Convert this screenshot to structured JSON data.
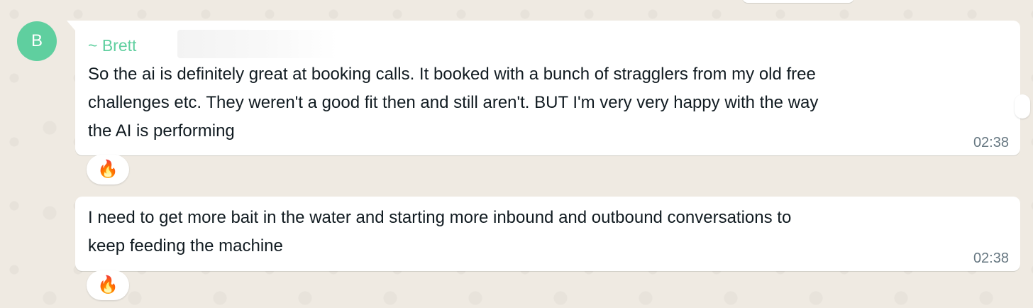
{
  "chat": {
    "avatar_initial": "B",
    "messages": [
      {
        "sender": "~ Brett",
        "text": "So the ai is definitely great at booking calls. It booked with a bunch of stragglers from my old free\nchallenges etc. They weren't a good fit then and still aren't. BUT I'm very very happy with the way\nthe AI is performing",
        "time": "02:38",
        "reaction": "🔥"
      },
      {
        "text": "I need to get more bait in the water and starting more inbound and outbound conversations to\nkeep feeding the machine",
        "time": "02:38",
        "reaction": "🔥"
      }
    ]
  },
  "colors": {
    "background": "#efeae2",
    "bubble": "#ffffff",
    "sender_name": "#5fcf9f",
    "avatar": "#5fcf9f",
    "timestamp": "#667781"
  },
  "icons": {
    "reaction": "fire-emoji"
  }
}
